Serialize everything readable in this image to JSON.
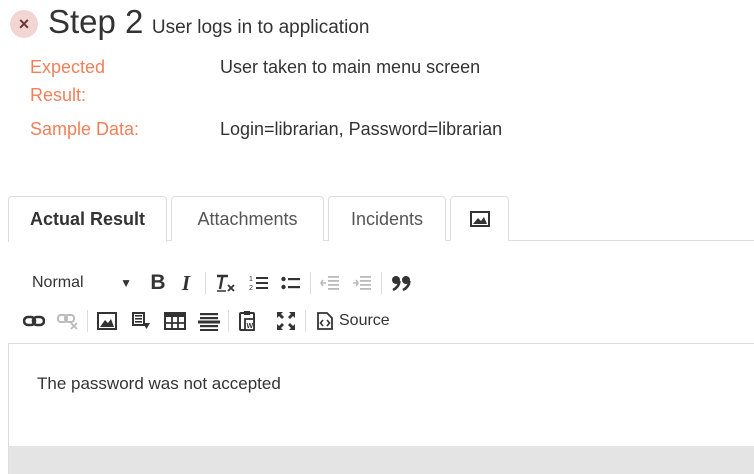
{
  "step": {
    "number_label": "Step 2",
    "description": "User logs in to application"
  },
  "fields": {
    "expected_label_line1": "Expected",
    "expected_label_line2": "Result:",
    "expected_value": "User taken to main menu screen",
    "sample_label": "Sample Data:",
    "sample_value": "Login=librarian, Password=librarian"
  },
  "tabs": {
    "actual_result": "Actual Result",
    "attachments": "Attachments",
    "incidents": "Incidents"
  },
  "toolbar": {
    "format_value": "Normal",
    "bold": "B",
    "italic": "I",
    "source_label": "Source"
  },
  "editor": {
    "content": "The password was not accepted"
  },
  "colors": {
    "label_accent": "#f07f5a",
    "close_bg": "#f3d6d2"
  }
}
